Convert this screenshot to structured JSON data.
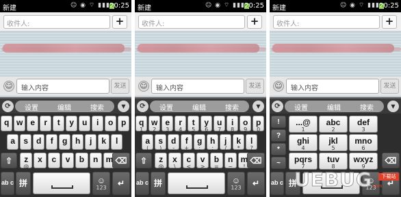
{
  "screens": [
    {
      "status": {
        "title": "新建",
        "icons": "☺ ◉ ⌔ ▮▮▮",
        "time": "20:25"
      },
      "recipient": {
        "placeholder": "收件人:",
        "add_label": "+"
      },
      "compose": {
        "placeholder": "输入内容",
        "send_label": "发送"
      },
      "toolbar": {
        "left_icon": "⟳",
        "settings": "设置",
        "edit": "编辑",
        "search": "搜索",
        "right_icon": "▼"
      },
      "keyboard": {
        "row1": [
          {
            "m": "q",
            "s": ""
          },
          {
            "m": "w",
            "s": ""
          },
          {
            "m": "e",
            "s": ""
          },
          {
            "m": "r",
            "s": ""
          },
          {
            "m": "t",
            "s": ""
          },
          {
            "m": "y",
            "s": ""
          },
          {
            "m": "u",
            "s": ""
          },
          {
            "m": "i",
            "s": ""
          },
          {
            "m": "o",
            "s": ""
          },
          {
            "m": "p",
            "s": ""
          }
        ],
        "row2": [
          {
            "m": "a",
            "s": ""
          },
          {
            "m": "s",
            "s": ""
          },
          {
            "m": "d",
            "s": ""
          },
          {
            "m": "f",
            "s": ""
          },
          {
            "m": "g",
            "s": ""
          },
          {
            "m": "h",
            "s": ""
          },
          {
            "m": "j",
            "s": ""
          },
          {
            "m": "k",
            "s": ""
          },
          {
            "m": "l",
            "s": ""
          }
        ],
        "row3": [
          {
            "m": "z",
            "s": "@"
          },
          {
            "m": "x",
            "s": ""
          },
          {
            "m": "c",
            "s": ""
          },
          {
            "m": "v",
            "s": ""
          },
          {
            "m": "b",
            "s": ""
          },
          {
            "m": "n",
            "s": ""
          },
          {
            "m": "m",
            "s": ""
          }
        ],
        "shift_label": "⇧",
        "delete_label": "⌫",
        "abc_label": "ab c",
        "pinyin_label": "拼",
        "emoji_label": "☺",
        "emoji_sub": "123",
        "space_label": "",
        "enter_label": "↵"
      }
    },
    {
      "status": {
        "title": "新建",
        "icons": "☺ ◉ ⌔ ▮▮▮",
        "time": "20:25"
      },
      "recipient": {
        "placeholder": "收件人:",
        "add_label": "+"
      },
      "compose": {
        "placeholder": "输入内容",
        "send_label": "发送"
      },
      "toolbar": {
        "left_icon": "⟳",
        "settings": "设置",
        "edit": "编辑",
        "search": "搜索",
        "right_icon": "▼"
      },
      "keyboard": {
        "row1": [
          {
            "m": "q",
            "s": "1"
          },
          {
            "m": "w",
            "s": "2"
          },
          {
            "m": "e",
            "s": "3"
          },
          {
            "m": "r",
            "s": "4"
          },
          {
            "m": "t",
            "s": "5"
          },
          {
            "m": "y",
            "s": "6"
          },
          {
            "m": "u",
            "s": "7"
          },
          {
            "m": "i",
            "s": "8"
          },
          {
            "m": "o",
            "s": "9"
          },
          {
            "m": "p",
            "s": "0"
          }
        ],
        "row2": [
          {
            "m": "a",
            "s": "("
          },
          {
            "m": "s",
            "s": ")"
          },
          {
            "m": "d",
            "s": "-"
          },
          {
            "m": "f",
            "s": "+"
          },
          {
            "m": "g",
            "s": ";"
          },
          {
            "m": "h",
            "s": ":"
          },
          {
            "m": "j",
            "s": "/"
          },
          {
            "m": "k",
            "s": "*"
          },
          {
            "m": "l",
            "s": "?"
          }
        ],
        "row3": [
          {
            "m": "z",
            "s": "@"
          },
          {
            "m": "x",
            "s": "\\"
          },
          {
            "m": "c",
            "s": "<"
          },
          {
            "m": "v",
            "s": ">"
          },
          {
            "m": "b",
            "s": "="
          },
          {
            "m": "n",
            "s": "~"
          },
          {
            "m": "m",
            "s": "!"
          }
        ],
        "shift_label": "⇧",
        "delete_label": "⌫",
        "abc_label": "ab c",
        "pinyin_label": "拼",
        "emoji_label": "☺",
        "emoji_sub": "123",
        "space_label": "",
        "enter_label": "↵"
      }
    },
    {
      "status": {
        "title": "新建",
        "icons": "☺ ◉ ⌔ ▮▮▮",
        "time": "20:25"
      },
      "recipient": {
        "placeholder": "收件人:",
        "add_label": "+"
      },
      "compose": {
        "placeholder": "输入内容",
        "send_label": "发送"
      },
      "toolbar": {
        "left_icon": "⟳",
        "settings": "设置",
        "edit": "编辑",
        "search": "搜索",
        "right_icon": "▼"
      },
      "keyboard": {
        "side": [
          "!",
          "?",
          "*",
          "~"
        ],
        "grid": [
          [
            {
              "m": "...@",
              "s": "1"
            },
            {
              "m": "abc",
              "s": "2"
            },
            {
              "m": "def",
              "s": "3"
            }
          ],
          [
            {
              "m": "ghi",
              "s": "4"
            },
            {
              "m": "jkl",
              "s": "5"
            },
            {
              "m": "mno",
              "s": "6"
            }
          ],
          [
            {
              "m": "pqrs",
              "s": "7"
            },
            {
              "m": "tuv",
              "s": "8"
            },
            {
              "m": "wxyz",
              "s": "9"
            }
          ]
        ],
        "delete_label": "⌫",
        "abc_label": "ab c",
        "pinyin_label": "拼",
        "emoji_label": "☺",
        "emoji_sub": "123",
        "space_label": "",
        "enter_label": "↵"
      }
    }
  ],
  "watermark": {
    "text": "UEBUG",
    "badge": "下载站",
    "domain": ".com"
  }
}
